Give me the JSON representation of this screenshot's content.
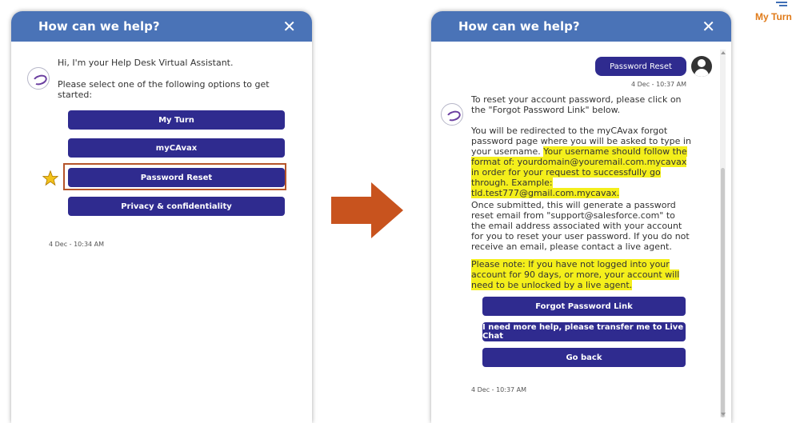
{
  "left_panel": {
    "title": "How can we help?",
    "greeting": "Hi, I'm your Help Desk Virtual Assistant.",
    "prompt": "Please select one of the following options to get started:",
    "options": [
      "My Turn",
      "myCAvax",
      "Password Reset",
      "Privacy & confidentiality"
    ],
    "timestamp": "4 Dec - 10:34 AM"
  },
  "right_panel": {
    "title": "How can we help?",
    "user_message": "Password Reset",
    "user_timestamp": "4 Dec - 10:37 AM",
    "reply_intro": "To reset your account password, please click on the \"Forgot Password Link\" below.",
    "reply_redirect_plain": "You will be redirected to the myCAvax forgot password page where you will be asked to type in your username.",
    "reply_redirect_highlight": "Your username should follow the format of: yourdomain@youremail.com.mycavax in order for your request to successfully go through. Example: tld.test777@gmail.com.mycavax.",
    "reply_submitted": "Once submitted, this will generate a password reset email from \"support@salesforce.com\" to the email address associated with your account for you to reset your user password. If you do not receive an email, please contact a live agent.",
    "reply_note": "Please note: If you have not logged into your account for 90 days, or more, your account will need to be unlocked by a live agent.",
    "buttons": [
      "Forgot Password Link",
      "I need more help, please transfer me to Live Chat",
      "Go back"
    ],
    "bot_timestamp": "4 Dec - 10:37 AM"
  },
  "brand": {
    "logo_text": "My Turn"
  },
  "colors": {
    "header": "#4a73b7",
    "button": "#2f2b8f",
    "highlight": "#f4ef1b",
    "arrow": "#c8531e",
    "selection_outline": "#b5542a",
    "star": "#f2c21b"
  },
  "icons": [
    "close-icon",
    "bot-avatar-icon",
    "user-avatar-icon",
    "star-icon",
    "arrow-right-icon",
    "my-turn-logo-icon"
  ]
}
